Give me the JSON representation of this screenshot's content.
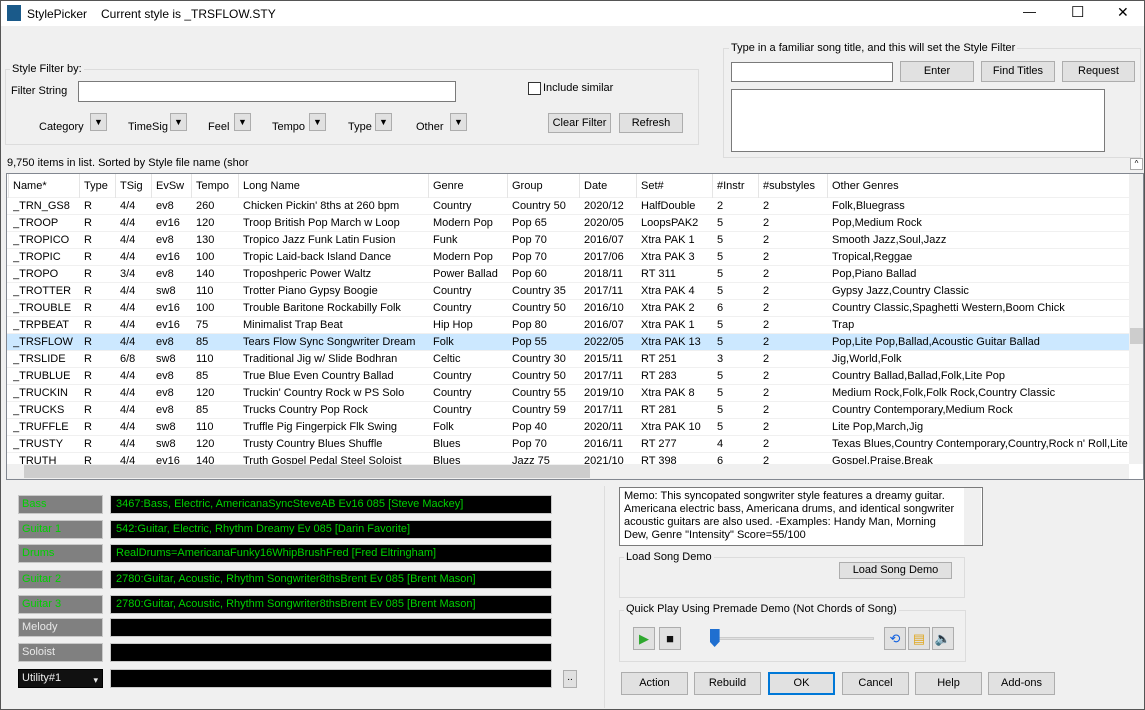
{
  "window": {
    "app_name": "StylePicker",
    "title": "Current style is _TRSFLOW.STY",
    "minimize": "—",
    "maximize": "☐",
    "close": "✕"
  },
  "filter": {
    "group_label": "Style Filter by:",
    "filter_string_label": "Filter String",
    "filter_string_value": "",
    "include_similar_label": "Include similar",
    "include_similar_checked": false,
    "dropdowns": [
      {
        "label": "Category"
      },
      {
        "label": "TimeSig"
      },
      {
        "label": "Feel"
      },
      {
        "label": "Tempo"
      },
      {
        "label": "Type"
      },
      {
        "label": "Other"
      }
    ],
    "clear_label": "Clear Filter",
    "refresh_label": "Refresh"
  },
  "song_title": {
    "group_label": "Type in a familiar song title, and this will set the Style Filter",
    "input_value": "",
    "enter_label": "Enter",
    "find_titles_label": "Find Titles",
    "request_label": "Request",
    "results": ""
  },
  "status": "9,750 items in list. Sorted by Style file name (shor",
  "table": {
    "columns": [
      "Name*",
      "Type",
      "TSig",
      "EvSw",
      "Tempo",
      "Long Name",
      "Genre",
      "Group",
      "Date",
      "Set#",
      "#Instr",
      "#substyles",
      "Other Genres"
    ],
    "selected_index": 8,
    "rows": [
      [
        "_TRN_GS8",
        "R",
        "4/4",
        "ev8",
        "260",
        "Chicken Pickin' 8ths at 260 bpm",
        "Country",
        "Country 50",
        "2020/12",
        "HalfDouble",
        "2",
        "2",
        "Folk,Bluegrass"
      ],
      [
        "_TROOP",
        "R",
        "4/4",
        "ev16",
        "120",
        "Troop British Pop March w Loop",
        "Modern Pop",
        "Pop 65",
        "2020/05",
        "LoopsPAK2",
        "5",
        "2",
        "Pop,Medium Rock"
      ],
      [
        "_TROPICO",
        "R",
        "4/4",
        "ev8",
        "130",
        "Tropico Jazz Funk Latin Fusion",
        "Funk",
        "Pop 70",
        "2016/07",
        "Xtra PAK 1",
        "5",
        "2",
        "Smooth Jazz,Soul,Jazz"
      ],
      [
        "_TROPIC",
        "R",
        "4/4",
        "ev16",
        "100",
        "Tropic Laid-back Island Dance",
        "Modern Pop",
        "Pop 70",
        "2017/06",
        "Xtra PAK 3",
        "5",
        "2",
        "Tropical,Reggae"
      ],
      [
        "_TROPO",
        "R",
        "3/4",
        "ev8",
        "140",
        "Troposhperic Power Waltz",
        "Power Ballad",
        "Pop 60",
        "2018/11",
        "RT 311",
        "5",
        "2",
        "Pop,Piano Ballad"
      ],
      [
        "_TROTTER",
        "R",
        "4/4",
        "sw8",
        "110",
        "Trotter Piano Gypsy Boogie",
        "Country",
        "Country 35",
        "2017/11",
        "Xtra PAK 4",
        "5",
        "2",
        "Gypsy Jazz,Country Classic"
      ],
      [
        "_TROUBLE",
        "R",
        "4/4",
        "ev16",
        "100",
        "Trouble Baritone Rockabilly Folk",
        "Country",
        "Country 50",
        "2016/10",
        "Xtra PAK 2",
        "6",
        "2",
        "Country Classic,Spaghetti Western,Boom Chick"
      ],
      [
        "_TRPBEAT",
        "R",
        "4/4",
        "ev16",
        "75",
        "Minimalist Trap Beat",
        "Hip Hop",
        "Pop 80",
        "2016/07",
        "Xtra PAK 1",
        "5",
        "2",
        "Trap"
      ],
      [
        "_TRSFLOW",
        "R",
        "4/4",
        "ev8",
        "85",
        "Tears Flow Sync Songwriter Dream",
        "Folk",
        "Pop 55",
        "2022/05",
        "Xtra PAK 13",
        "5",
        "2",
        "Pop,Lite Pop,Ballad,Acoustic Guitar Ballad"
      ],
      [
        "_TRSLIDE",
        "R",
        "6/8",
        "sw8",
        "110",
        "Traditional Jig w/ Slide Bodhran",
        "Celtic",
        "Country 30",
        "2015/11",
        "RT 251",
        "3",
        "2",
        "Jig,World,Folk"
      ],
      [
        "_TRUBLUE",
        "R",
        "4/4",
        "ev8",
        "85",
        "True Blue Even Country Ballad",
        "Country",
        "Country 50",
        "2017/11",
        "RT 283",
        "5",
        "2",
        "Country Ballad,Ballad,Folk,Lite Pop"
      ],
      [
        "_TRUCKIN",
        "R",
        "4/4",
        "ev8",
        "120",
        "Truckin' Country Rock w PS Solo",
        "Country",
        "Country 55",
        "2019/10",
        "Xtra PAK 8",
        "5",
        "2",
        "Medium Rock,Folk,Folk Rock,Country Classic"
      ],
      [
        "_TRUCKS",
        "R",
        "4/4",
        "ev8",
        "85",
        "Trucks Country Pop Rock",
        "Country",
        "Country 59",
        "2017/11",
        "RT 281",
        "5",
        "2",
        "Country Contemporary,Medium Rock"
      ],
      [
        "_TRUFFLE",
        "R",
        "4/4",
        "sw8",
        "110",
        "Truffle Pig Fingerpick Flk Swing",
        "Folk",
        "Pop 40",
        "2020/11",
        "Xtra PAK 10",
        "5",
        "2",
        "Lite Pop,March,Jig"
      ],
      [
        "_TRUSTY",
        "R",
        "4/4",
        "sw8",
        "120",
        "Trusty Country Blues Shuffle",
        "Blues",
        "Pop 70",
        "2016/11",
        "RT 277",
        "4",
        "2",
        "Texas Blues,Country Contemporary,Country,Rock n' Roll,Lite"
      ],
      [
        "_TRUTH",
        "R",
        "4/4",
        "ev16",
        "140",
        "Truth Gospel Pedal Steel Soloist",
        "Blues",
        "Jazz 75",
        "2021/10",
        "RT 398",
        "6",
        "2",
        "Gospel,Praise,Break"
      ]
    ]
  },
  "instruments": [
    {
      "label": "Bass",
      "value": "3467:Bass, Electric, AmericanaSyncSteveAB Ev16 085 [Steve Mackey]"
    },
    {
      "label": "Guitar 1",
      "value": "542:Guitar, Electric, Rhythm Dreamy Ev 085 [Darin Favorite]"
    },
    {
      "label": "Drums",
      "value": "RealDrums=AmericanaFunky16WhipBrushFred [Fred Eltringham]"
    },
    {
      "label": "Guitar 2",
      "value": "2780:Guitar, Acoustic, Rhythm Songwriter8thsBrent Ev 085 [Brent Mason]"
    },
    {
      "label": "Guitar 3",
      "value": "2780:Guitar, Acoustic, Rhythm Songwriter8thsBrent Ev 085 [Brent Mason]"
    },
    {
      "label": "Melody",
      "value": ""
    },
    {
      "label": "Soloist",
      "value": ""
    },
    {
      "label": "Utility#1",
      "value": ""
    }
  ],
  "more_button": "..",
  "memo": "Memo: This syncopated songwriter style features a dreamy guitar. Americana electric bass, Americana drums, and identical songwriter acoustic guitars are also used. -Examples: Handy Man, Morning Dew, Genre \"Intensity\" Score=55/100",
  "load_demo": {
    "group_label": "Load Song Demo",
    "button_label": "Load Song Demo"
  },
  "quick_play": {
    "group_label": "Quick Play Using Premade Demo (Not Chords of Song)",
    "position": 0.01
  },
  "buttons": {
    "action": "Action",
    "rebuild": "Rebuild",
    "ok": "OK",
    "cancel": "Cancel",
    "help": "Help",
    "addons": "Add-ons"
  }
}
